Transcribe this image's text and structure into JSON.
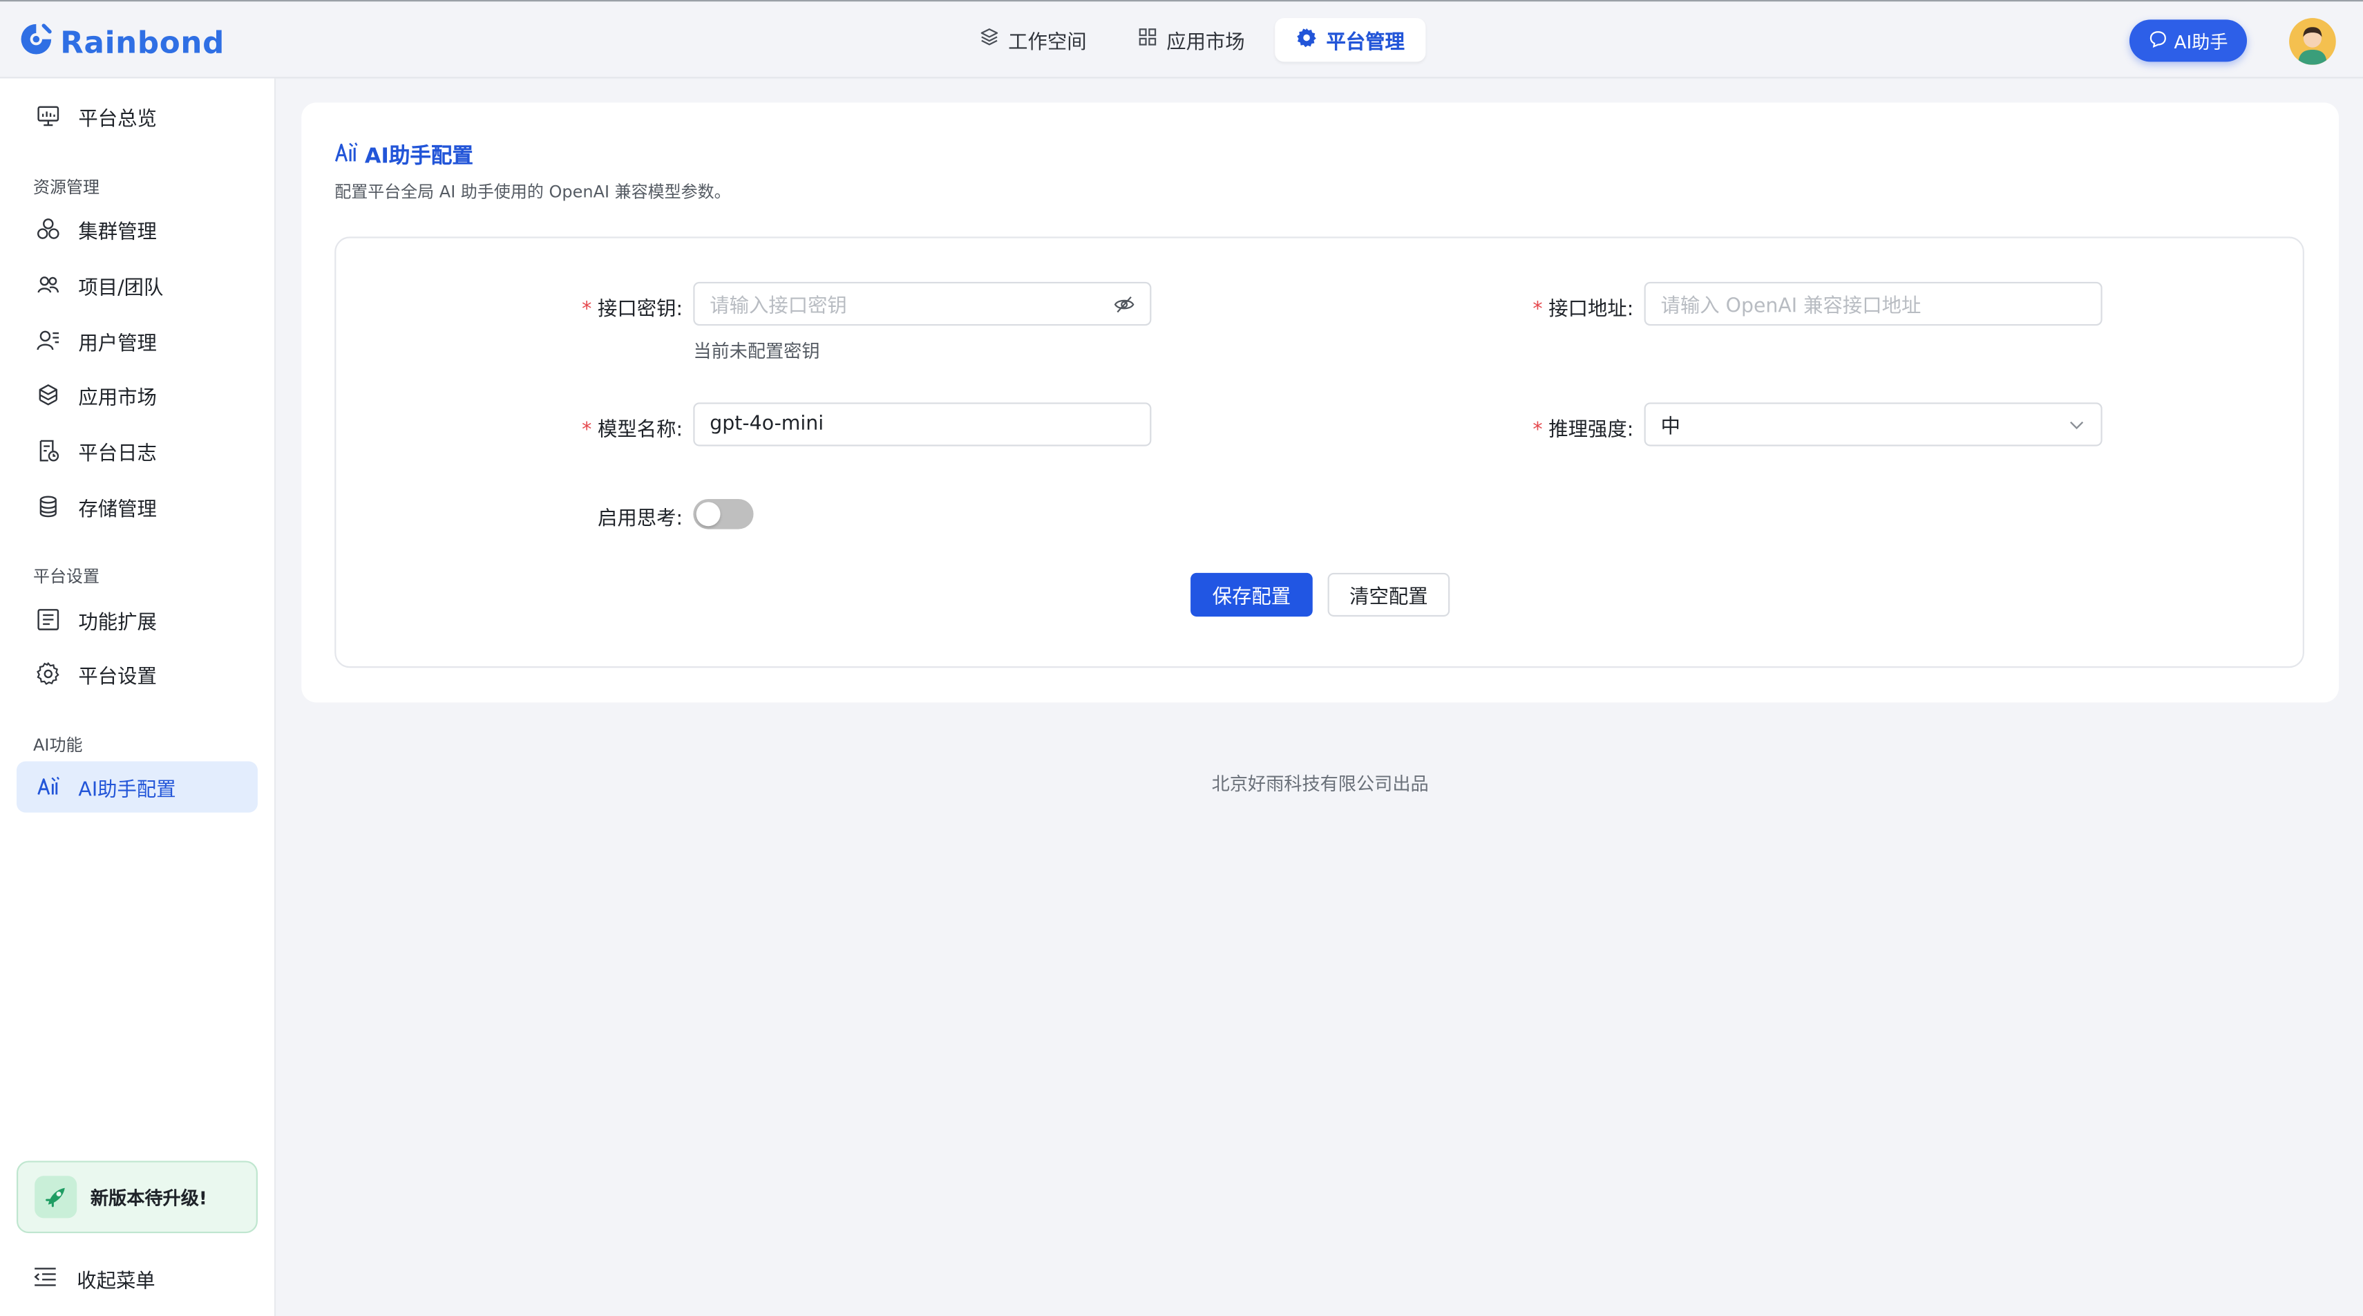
{
  "brand": {
    "name": "Rainbond",
    "color": "#2f6fe4"
  },
  "topnav": {
    "tabs": [
      {
        "label": "工作空间",
        "icon": "layers-icon"
      },
      {
        "label": "应用市场",
        "icon": "grid-icon"
      },
      {
        "label": "平台管理",
        "icon": "gear-icon",
        "active": true
      }
    ],
    "ai_button": "AI助手"
  },
  "sidebar": {
    "overview": "平台总览",
    "group_resource": "资源管理",
    "resource_items": [
      "集群管理",
      "项目/团队",
      "用户管理",
      "应用市场",
      "平台日志",
      "存储管理"
    ],
    "group_platform": "平台设置",
    "platform_items": [
      "功能扩展",
      "平台设置"
    ],
    "group_ai": "AI功能",
    "ai_items": [
      "AI助手配置"
    ],
    "upgrade": "新版本待升级!",
    "collapse": "收起菜单"
  },
  "page": {
    "title": "AI助手配置",
    "description": "配置平台全局 AI 助手使用的 OpenAI 兼容模型参数。"
  },
  "form": {
    "api_key": {
      "label": "接口密钥",
      "placeholder": "请输入接口密钥",
      "hint": "当前未配置密钥"
    },
    "api_url": {
      "label": "接口地址",
      "placeholder": "请输入 OpenAI 兼容接口地址"
    },
    "model": {
      "label": "模型名称",
      "value": "gpt-4o-mini"
    },
    "reasoning": {
      "label": "推理强度",
      "value": "中"
    },
    "thinking": {
      "label": "启用思考",
      "enabled": false
    },
    "save": "保存配置",
    "clear": "清空配置",
    "colon": ":"
  },
  "footer": "北京好雨科技有限公司出品",
  "colors": {
    "accent": "#2156e3",
    "required": "#e5484d",
    "active_bg": "#e3edfd"
  }
}
